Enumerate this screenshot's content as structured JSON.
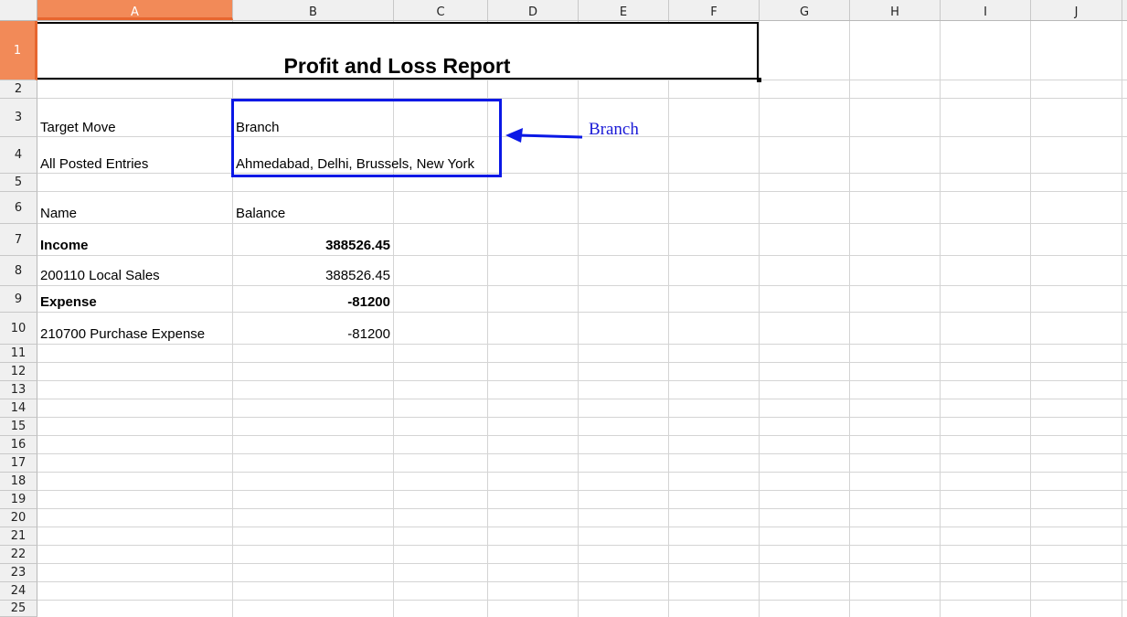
{
  "columns": [
    "A",
    "B",
    "C",
    "D",
    "E",
    "F",
    "G",
    "H",
    "I",
    "J"
  ],
  "selected_column": "A",
  "rows": [
    "1",
    "2",
    "3",
    "4",
    "5",
    "6",
    "7",
    "8",
    "9",
    "10",
    "11",
    "12",
    "13",
    "14",
    "15",
    "16",
    "17",
    "18",
    "19",
    "20",
    "21",
    "22",
    "23",
    "24",
    "25"
  ],
  "selected_row": "1",
  "report": {
    "title": "Profit and Loss Report",
    "target_move_label": "Target Move",
    "target_move_value": "Branch",
    "posted_label": "All Posted Entries",
    "branches": "Ahmedabad, Delhi, Brussels, New York",
    "header_name": "Name",
    "header_balance": "Balance",
    "lines": [
      {
        "name": "Income",
        "balance": "388526.45",
        "bold": true
      },
      {
        "name": "200110 Local Sales",
        "balance": "388526.45",
        "bold": false
      },
      {
        "name": "Expense",
        "balance": "-81200",
        "bold": true
      },
      {
        "name": "210700 Purchase Expense",
        "balance": "-81200",
        "bold": false
      }
    ]
  },
  "annotation": {
    "label": "Branch",
    "color": "#0a18e6"
  },
  "colors": {
    "selected_header": "#f28a58",
    "grid": "#d4d4d4"
  }
}
